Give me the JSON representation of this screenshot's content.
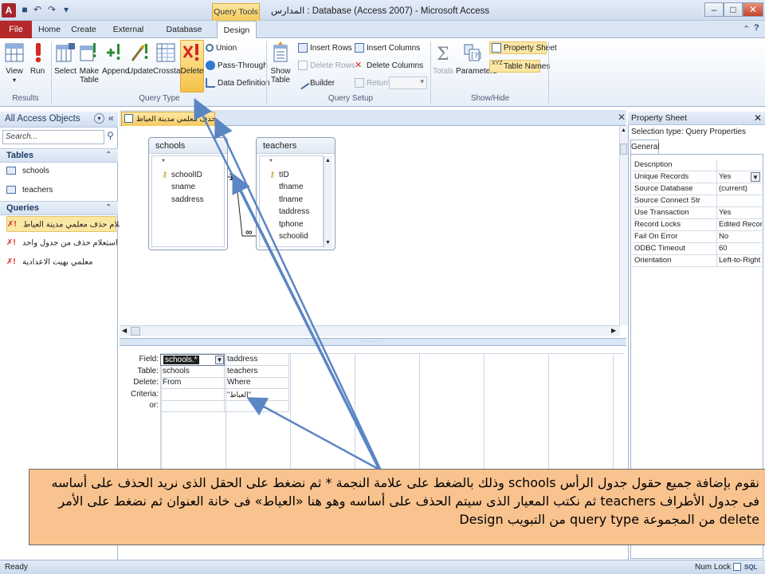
{
  "window": {
    "title": "المدارس : Database (Access 2007) - Microsoft Access",
    "context_tab": "Query Tools"
  },
  "ribbon": {
    "tabs": [
      "File",
      "Home",
      "Create",
      "External Data",
      "Database Tools",
      "Design"
    ],
    "active_tab": "Design",
    "groups": {
      "results": {
        "label": "Results",
        "buttons": [
          "View",
          "Run"
        ]
      },
      "query_type": {
        "label": "Query Type",
        "buttons": [
          "Select",
          "Make Table",
          "Append",
          "Update",
          "Crosstab",
          "Delete"
        ],
        "small": [
          "Union",
          "Pass-Through",
          "Data Definition"
        ]
      },
      "query_setup": {
        "label": "Query Setup",
        "big": "Show Table",
        "small": [
          "Insert Rows",
          "Delete Rows",
          "Builder",
          "Insert Columns",
          "Delete Columns",
          "Return:"
        ]
      },
      "show_hide": {
        "label": "Show/Hide",
        "buttons": [
          "Totals",
          "Parameters"
        ],
        "small": [
          "Property Sheet",
          "Table Names"
        ]
      }
    }
  },
  "nav": {
    "header": "All Access Objects",
    "search_placeholder": "Search...",
    "sections": [
      {
        "title": "Tables",
        "items": [
          "schools",
          "teachers"
        ]
      },
      {
        "title": "Queries",
        "items": [
          "استعلام حذف معلمي مدينة العياط",
          "استعلام حذف من جدول واحد",
          "معلمي بهيت الاعدادية"
        ]
      }
    ]
  },
  "doc": {
    "tab_title": "استعلام حذف معلمي مدينة العياط",
    "tables": [
      {
        "name": "schools",
        "fields": [
          "*",
          "schoolID",
          "sname",
          "saddress"
        ],
        "key": "schoolID"
      },
      {
        "name": "teachers",
        "fields": [
          "*",
          "tID",
          "tfname",
          "tlname",
          "taddress",
          "tphone",
          "schoolid"
        ],
        "key": "tID"
      }
    ],
    "relation_label": "∞",
    "grid": {
      "row_labels": [
        "Field:",
        "Table:",
        "Delete:",
        "Criteria:",
        "or:"
      ],
      "columns": [
        {
          "field": "schools.*",
          "table": "schools",
          "delete": "From",
          "criteria": "",
          "or": ""
        },
        {
          "field": "taddress",
          "table": "teachers",
          "delete": "Where",
          "criteria": "\"العياط\"",
          "or": ""
        }
      ]
    }
  },
  "property_sheet": {
    "title": "Property Sheet",
    "selection_type": "Selection type:  Query Properties",
    "tab": "General",
    "rows": [
      {
        "name": "Description",
        "value": ""
      },
      {
        "name": "Unique Records",
        "value": "Yes"
      },
      {
        "name": "Source Database",
        "value": "(current)"
      },
      {
        "name": "Source Connect Str",
        "value": ""
      },
      {
        "name": "Use Transaction",
        "value": "Yes"
      },
      {
        "name": "Record Locks",
        "value": "Edited Record"
      },
      {
        "name": "Fail On Error",
        "value": "No"
      },
      {
        "name": "ODBC Timeout",
        "value": "60"
      },
      {
        "name": "Orientation",
        "value": "Left-to-Right"
      }
    ]
  },
  "status": {
    "left": "Ready",
    "num_lock": "Num Lock",
    "sql": "SQL"
  },
  "annotation": {
    "text": "نقوم بإضافة جميع حقول جدول الرأس schools وذلك بالضغط على علامة النجمة * ثم نضغط على الحقل الذى نريد الحذف على أساسه فى جدول الأطراف teachers ثم نكتب المعيار الذى سيتم الحذف على أساسه وهو هنا «العياط» فى خانة العنوان ثم نضغط على الأمر delete من المجموعة query type من التبويب Design"
  },
  "colors": {
    "accent": "#b4292a",
    "highlight": "#fbe7a4",
    "annotation_bg": "#f9c38f",
    "arrow": "#5b86c4"
  }
}
